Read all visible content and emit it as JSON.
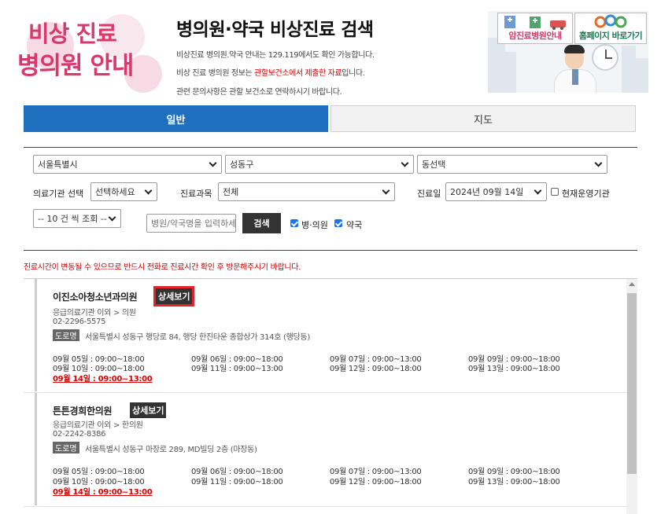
{
  "header": {
    "logo_line1": "비상 진료",
    "logo_line2": "병의원 안내",
    "title": "병의원·약국 비상진료 검색",
    "desc1": "비상진료 병의원.약국 안내는 129.119에서도 확인 가능합니다.",
    "desc2_pre": "비상 진료 병의원 정보는 ",
    "desc2_red": "관할보건소에서 제출한 자료",
    "desc2_post": "입니다.",
    "desc3": "관련 문의사항은 관할 보건소로 연락하시기 바랍니다."
  },
  "banner": {
    "cancer_label": "암진료병원안내",
    "homepage_label": "홈페이지 바로가기"
  },
  "tabs": [
    {
      "label": "일반",
      "active": true
    },
    {
      "label": "지도",
      "active": false
    }
  ],
  "filter": {
    "city": "서울특별시",
    "district": "성동구",
    "dong": "동선택",
    "inst_label": "의료기관 선택",
    "inst_value": "선택하세요",
    "dept_label": "진료과목",
    "dept_value": "전체",
    "date_label": "진료일",
    "date_value": "2024년 09월 14일",
    "operating_label": "현재운영기관",
    "page_size": "-- 10 건 씩 조회 --",
    "search_placeholder": "병원/약국명을 입력하세요",
    "search_button": "검색",
    "chk_hospital": "병·의원",
    "chk_pharmacy": "약국"
  },
  "notice": "진료시간이 변동될 수 있으므로 반드시 전화로 진료시간 확인 후 방문해주시기 바랍니다.",
  "colors": {
    "accent": "#1f6fbf",
    "logo": "#d9386a",
    "highlight": "#e0242a"
  },
  "results": [
    {
      "name": "이진소아청소년과의원",
      "detail": "상세보기",
      "category": "응급의료기관 이외 > 의원",
      "phone": "02-2296-5575",
      "road_tag": "도로명",
      "address": "서울특별시 성동구 행당로 84, 행당 한진타운 종합상가 314호 (행당동)",
      "hours": [
        "09월 05일 : 09:00~18:00",
        "09월 06일 : 09:00~18:00",
        "09월 07일 : 09:00~13:00",
        "09월 09일 : 09:00~18:00",
        "09월 10일 : 09:00~18:00",
        "09월 11일 : 09:00~13:00",
        "09월 12일 : 09:00~18:00",
        "09월 13일 : 09:00~18:00",
        "09월 14일 : 09:00~13:00"
      ]
    },
    {
      "name": "튼튼경희한의원",
      "detail": "상세보기",
      "category": "응급의료기관 이외 > 한의원",
      "phone": "02-2242-8386",
      "road_tag": "도로명",
      "address": "서울특별시 성동구 마장로 289, MD빌딩 2층 (마장동)",
      "hours": [
        "09월 05일 : 09:00~18:00",
        "09월 06일 : 09:00~18:00",
        "09월 07일 : 09:00~13:00",
        "09월 09일 : 09:00~18:00",
        "09월 10일 : 09:00~18:00",
        "09월 11일 : 09:00~18:00",
        "09월 12일 : 09:00~18:00",
        "09월 13일 : 09:00~18:00",
        "09월 14일 : 09:00~13:00"
      ]
    }
  ]
}
